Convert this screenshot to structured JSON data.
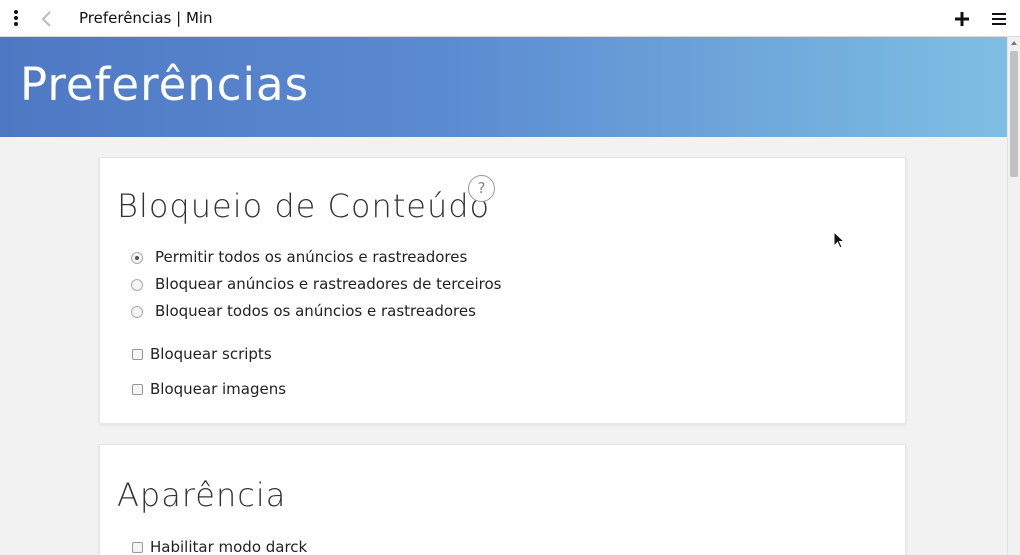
{
  "window": {
    "title": "Preferências | Min"
  },
  "hero": {
    "title": "Preferências"
  },
  "content_blocking": {
    "title": "Bloqueio de Conteúdo",
    "help_label": "?",
    "options": [
      {
        "label": "Permitir todos os anúncios e rastreadores",
        "selected": true
      },
      {
        "label": "Bloquear anúncios e rastreadores de terceiros",
        "selected": false
      },
      {
        "label": "Bloquear todos os anúncios e rastreadores",
        "selected": false
      }
    ],
    "checkboxes": [
      {
        "label": "Bloquear scripts",
        "checked": false
      },
      {
        "label": "Bloquear imagens",
        "checked": false
      }
    ]
  },
  "appearance": {
    "title": "Aparência",
    "checkboxes": [
      {
        "label": "Habilitar modo darck",
        "checked": false
      }
    ]
  },
  "icons": [
    "kebab-menu-icon",
    "back-arrow-icon",
    "plus-icon",
    "hamburger-menu-icon",
    "help-icon",
    "mouse-cursor-icon"
  ],
  "colors": {
    "hero_start": "#4f78c4",
    "hero_end": "#7fbfe3",
    "background": "#f2f2f2"
  }
}
